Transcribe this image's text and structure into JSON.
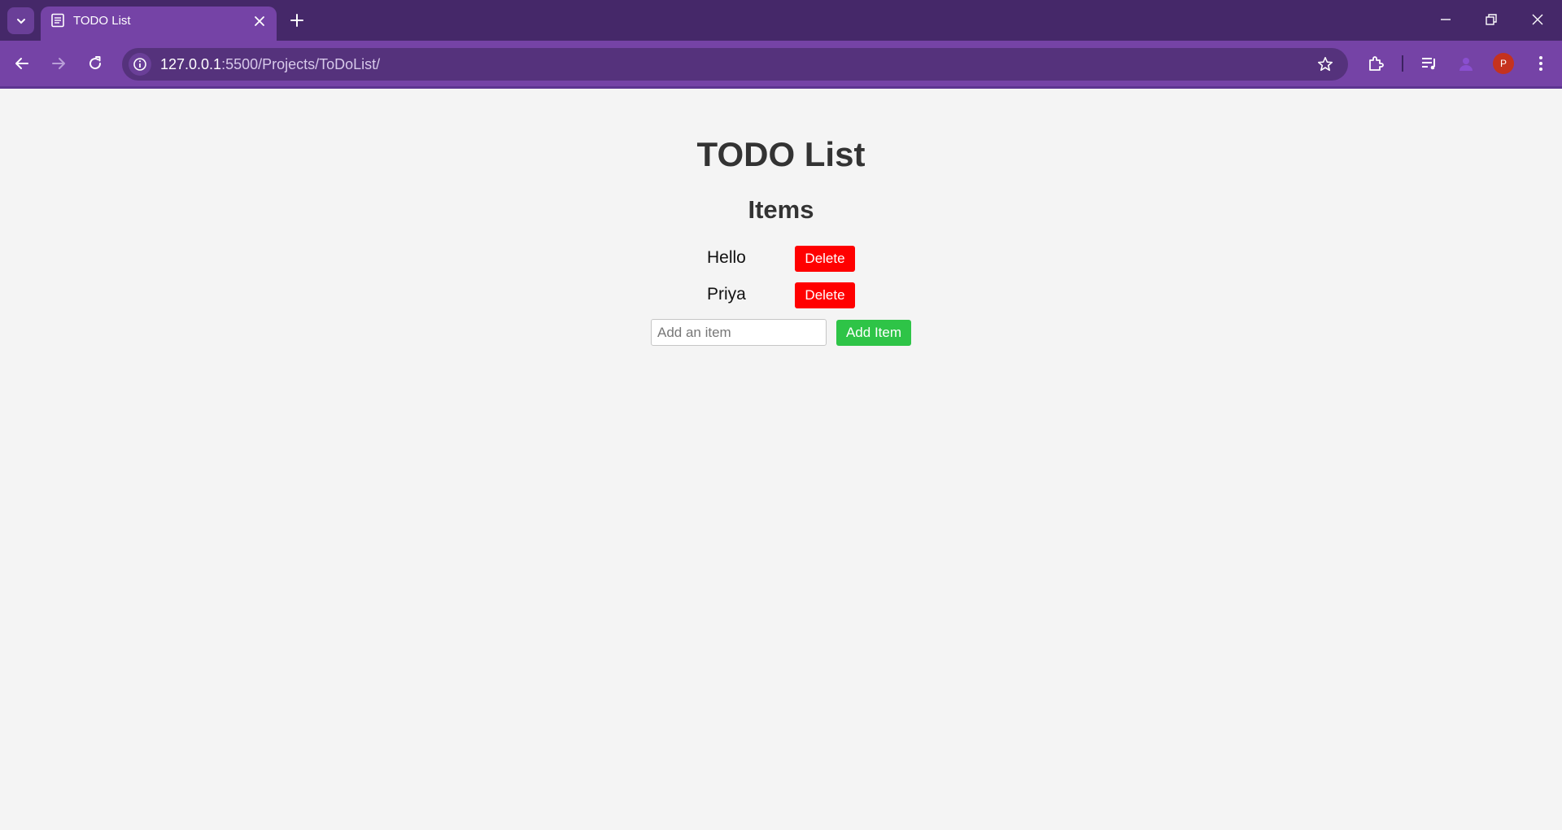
{
  "browser": {
    "tab": {
      "title": "TODO List"
    },
    "url": {
      "host": "127.0.0.1",
      "rest": ":5500/Projects/ToDoList/"
    },
    "profile_initial": "P",
    "colors": {
      "tabbar": "#452869",
      "toolbar": "#7543a6",
      "omnibox": "#55327c"
    }
  },
  "page": {
    "title": "TODO List",
    "section_title": "Items",
    "items": [
      {
        "text": "Hello",
        "delete_label": "Delete"
      },
      {
        "text": "Priya",
        "delete_label": "Delete"
      }
    ],
    "input": {
      "placeholder": "Add an item",
      "value": ""
    },
    "add_label": "Add Item",
    "colors": {
      "delete": "#ff0000",
      "add": "#2ec447"
    }
  }
}
